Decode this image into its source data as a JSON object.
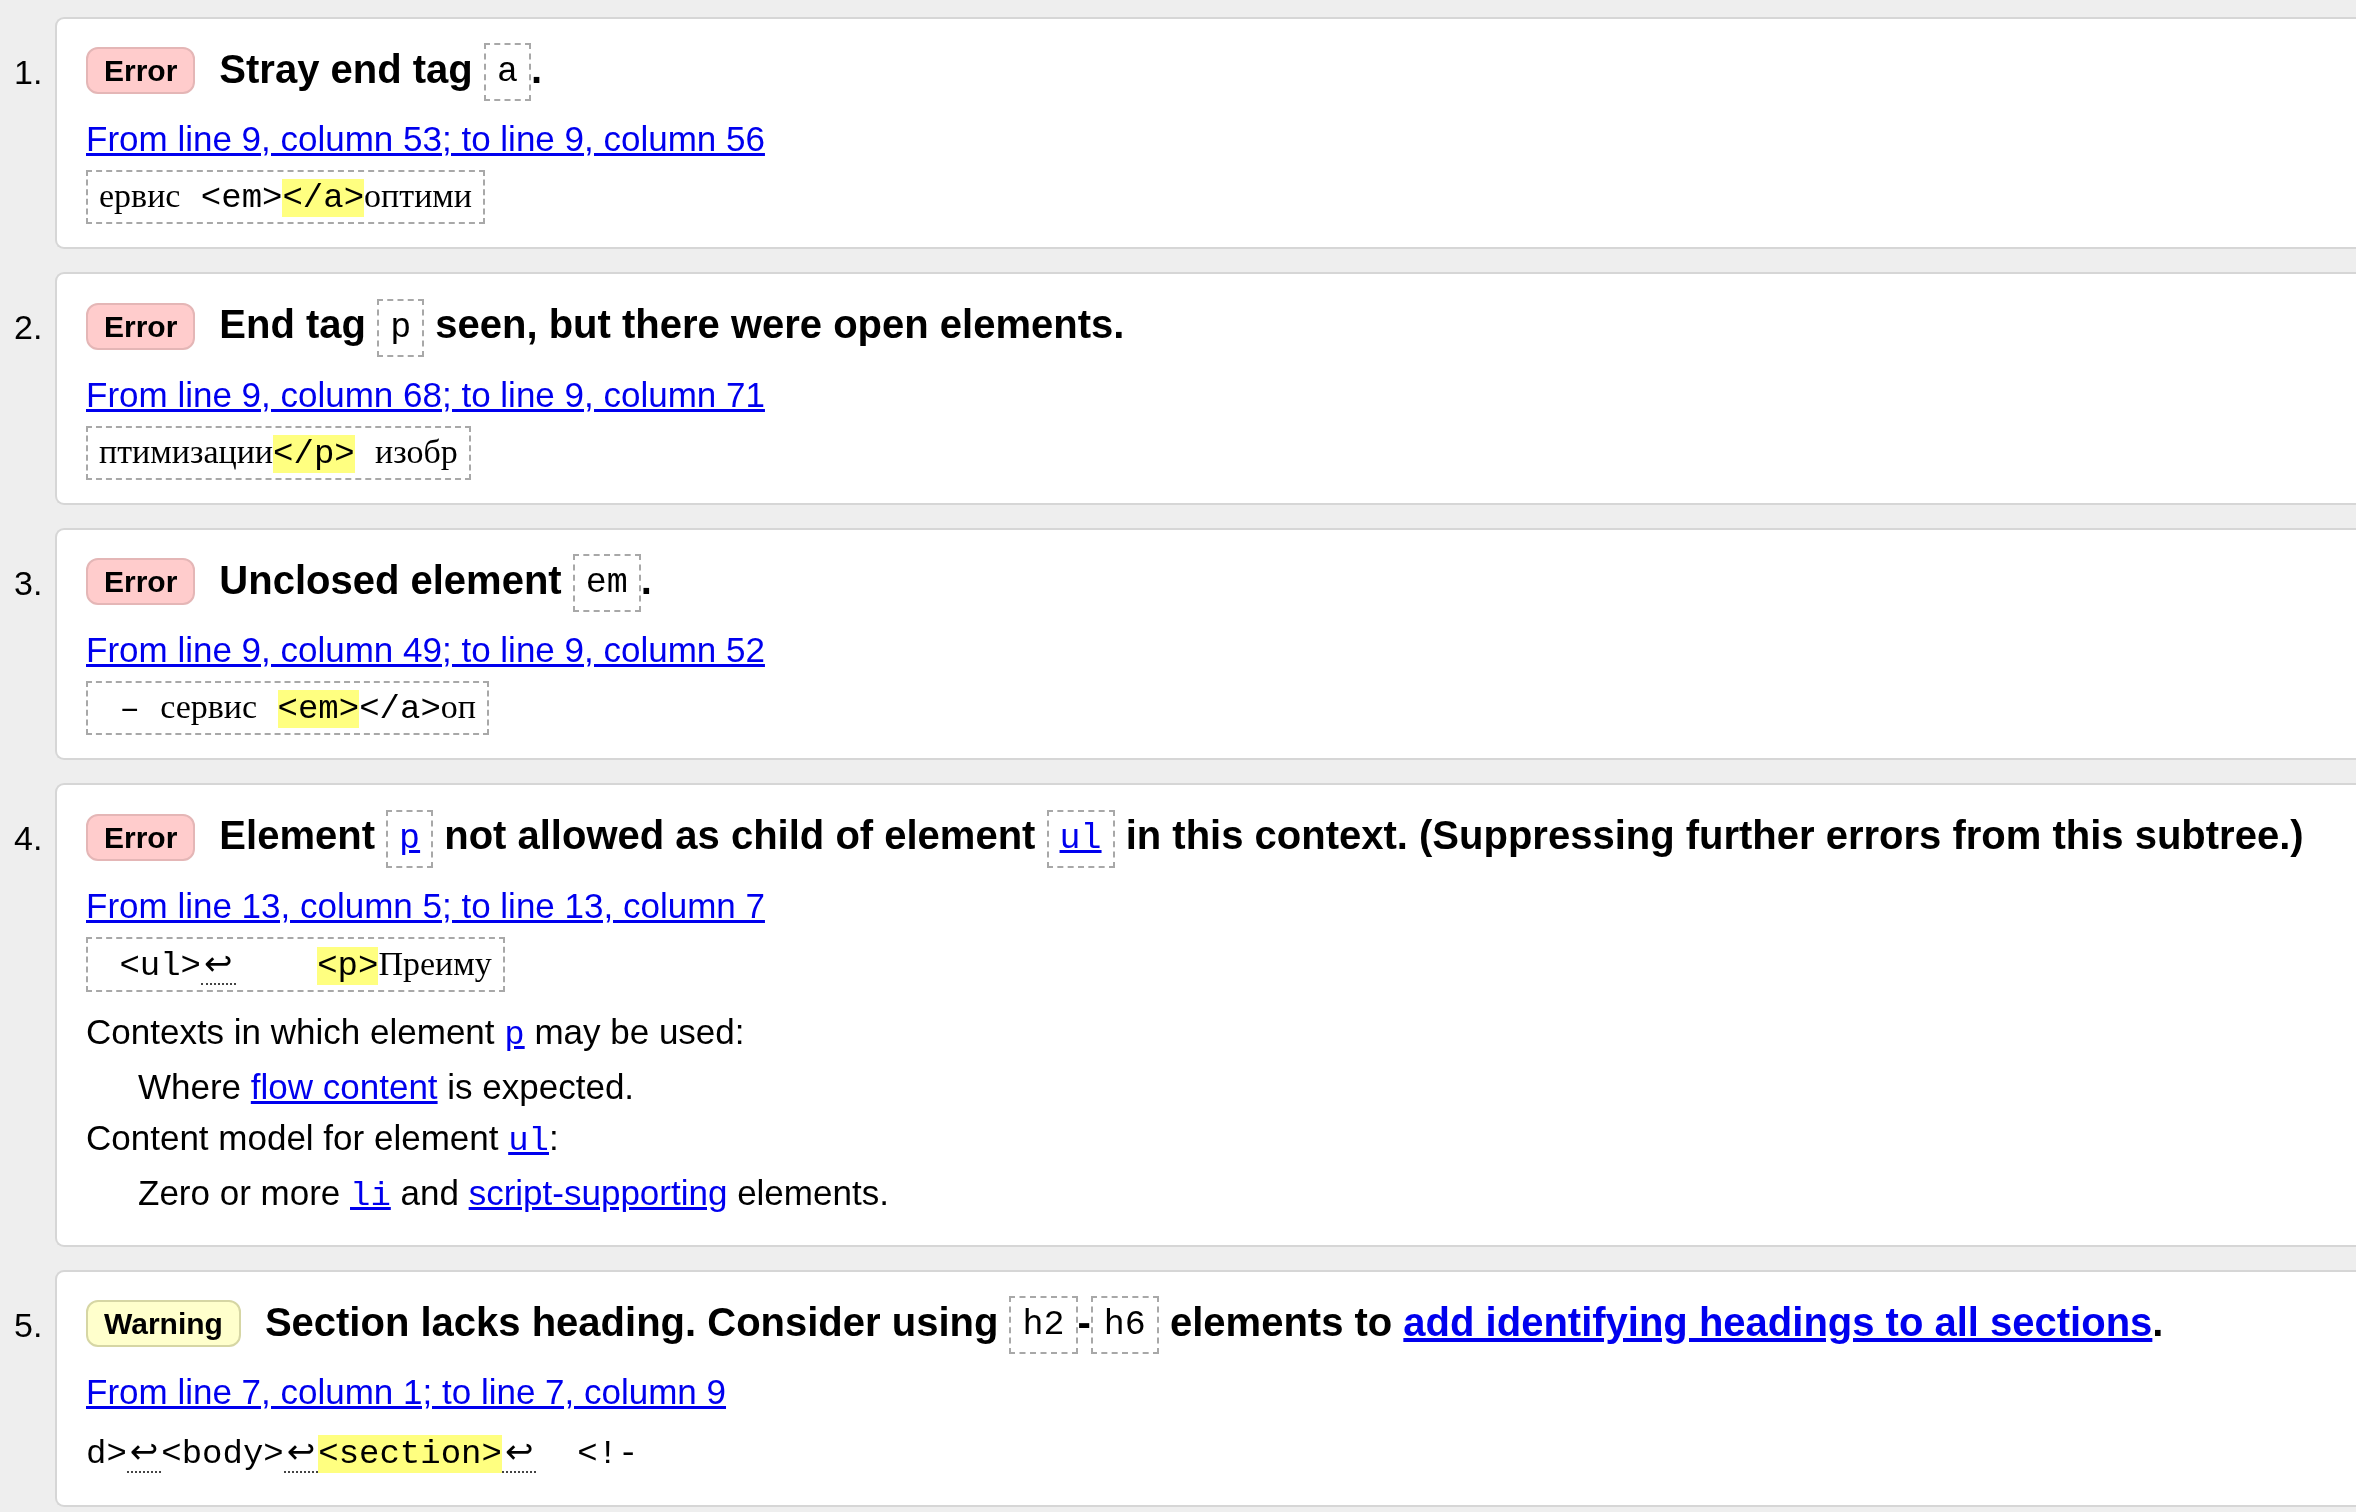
{
  "messages": [
    {
      "number": "1.",
      "kind": "error",
      "severity": "Error",
      "title": [
        {
          "kind": "text",
          "text": "Stray end tag "
        },
        {
          "kind": "term",
          "text": "a"
        },
        {
          "kind": "text",
          "text": "."
        }
      ],
      "location": "From line 9, column 53; to line 9, column 56",
      "extract": {
        "boxed": true,
        "segments": [
          {
            "kind": "text",
            "text": "ервис <em>"
          },
          {
            "kind": "highlight",
            "text": "</a>"
          },
          {
            "kind": "text",
            "text": "оптими"
          }
        ]
      }
    },
    {
      "number": "2.",
      "kind": "error",
      "severity": "Error",
      "title": [
        {
          "kind": "text",
          "text": "End tag "
        },
        {
          "kind": "term",
          "text": "p"
        },
        {
          "kind": "text",
          "text": " seen, but there were open elements."
        }
      ],
      "location": "From line 9, column 68; to line 9, column 71",
      "extract": {
        "boxed": true,
        "segments": [
          {
            "kind": "text",
            "text": "птимизации"
          },
          {
            "kind": "highlight",
            "text": "</p>"
          },
          {
            "kind": "text",
            "text": " изобр"
          }
        ]
      }
    },
    {
      "number": "3.",
      "kind": "error",
      "severity": "Error",
      "title": [
        {
          "kind": "text",
          "text": "Unclosed element "
        },
        {
          "kind": "term",
          "text": "em"
        },
        {
          "kind": "text",
          "text": "."
        }
      ],
      "location": "From line 9, column 49; to line 9, column 52",
      "extract": {
        "boxed": true,
        "segments": [
          {
            "kind": "text",
            "text": " – сервис "
          },
          {
            "kind": "highlight",
            "text": "<em>"
          },
          {
            "kind": "text",
            "text": "</a>оп"
          }
        ]
      }
    },
    {
      "number": "4.",
      "kind": "error",
      "severity": "Error",
      "title": [
        {
          "kind": "text",
          "text": "Element "
        },
        {
          "kind": "term_link",
          "text": "p"
        },
        {
          "kind": "text",
          "text": " not allowed as child of element "
        },
        {
          "kind": "term_link",
          "text": "ul"
        },
        {
          "kind": "text",
          "text": " in this context. (Suppressing further errors from this subtree.)"
        }
      ],
      "location": "From line 13, column 5; to line 13, column 7",
      "extract": {
        "boxed": true,
        "segments": [
          {
            "kind": "text",
            "text": " <ul>"
          },
          {
            "kind": "newline",
            "text": "↩"
          },
          {
            "kind": "highlight",
            "text": "    <p>"
          },
          {
            "kind": "text",
            "text": "Преиму"
          }
        ]
      },
      "details": [
        {
          "parts": [
            {
              "kind": "text",
              "text": "Contexts in which element "
            },
            {
              "kind": "code_link",
              "text": "p"
            },
            {
              "kind": "text",
              "text": " may be used:"
            }
          ],
          "children": [
            {
              "parts": [
                {
                  "kind": "text",
                  "text": "Where "
                },
                {
                  "kind": "link",
                  "text": "flow content"
                },
                {
                  "kind": "text",
                  "text": " is expected."
                }
              ]
            }
          ]
        },
        {
          "parts": [
            {
              "kind": "text",
              "text": "Content model for element "
            },
            {
              "kind": "code_link",
              "text": "ul"
            },
            {
              "kind": "text",
              "text": ":"
            }
          ],
          "children": [
            {
              "parts": [
                {
                  "kind": "text",
                  "text": "Zero or more "
                },
                {
                  "kind": "code_link",
                  "text": "li"
                },
                {
                  "kind": "text",
                  "text": " and "
                },
                {
                  "kind": "link",
                  "text": "script-supporting"
                },
                {
                  "kind": "text",
                  "text": " elements."
                }
              ]
            }
          ]
        }
      ]
    },
    {
      "number": "5.",
      "kind": "warning",
      "severity": "Warning",
      "title": [
        {
          "kind": "text",
          "text": "Section lacks heading. Consider using "
        },
        {
          "kind": "term",
          "text": "h2"
        },
        {
          "kind": "text",
          "text": "-"
        },
        {
          "kind": "term",
          "text": "h6"
        },
        {
          "kind": "text",
          "text": " elements to "
        },
        {
          "kind": "link",
          "text": "add identifying headings to all sections"
        },
        {
          "kind": "text",
          "text": "."
        }
      ],
      "location": "From line 7, column 1; to line 7, column 9",
      "extract": {
        "boxed": false,
        "segments": [
          {
            "kind": "text",
            "text": "d>"
          },
          {
            "kind": "newline",
            "text": "↩"
          },
          {
            "kind": "text",
            "text": "<body>"
          },
          {
            "kind": "newline",
            "text": "↩"
          },
          {
            "kind": "highlight",
            "text": "<section>"
          },
          {
            "kind": "newline",
            "text": "↩"
          },
          {
            "kind": "text",
            "text": "  <!-"
          }
        ]
      }
    }
  ]
}
